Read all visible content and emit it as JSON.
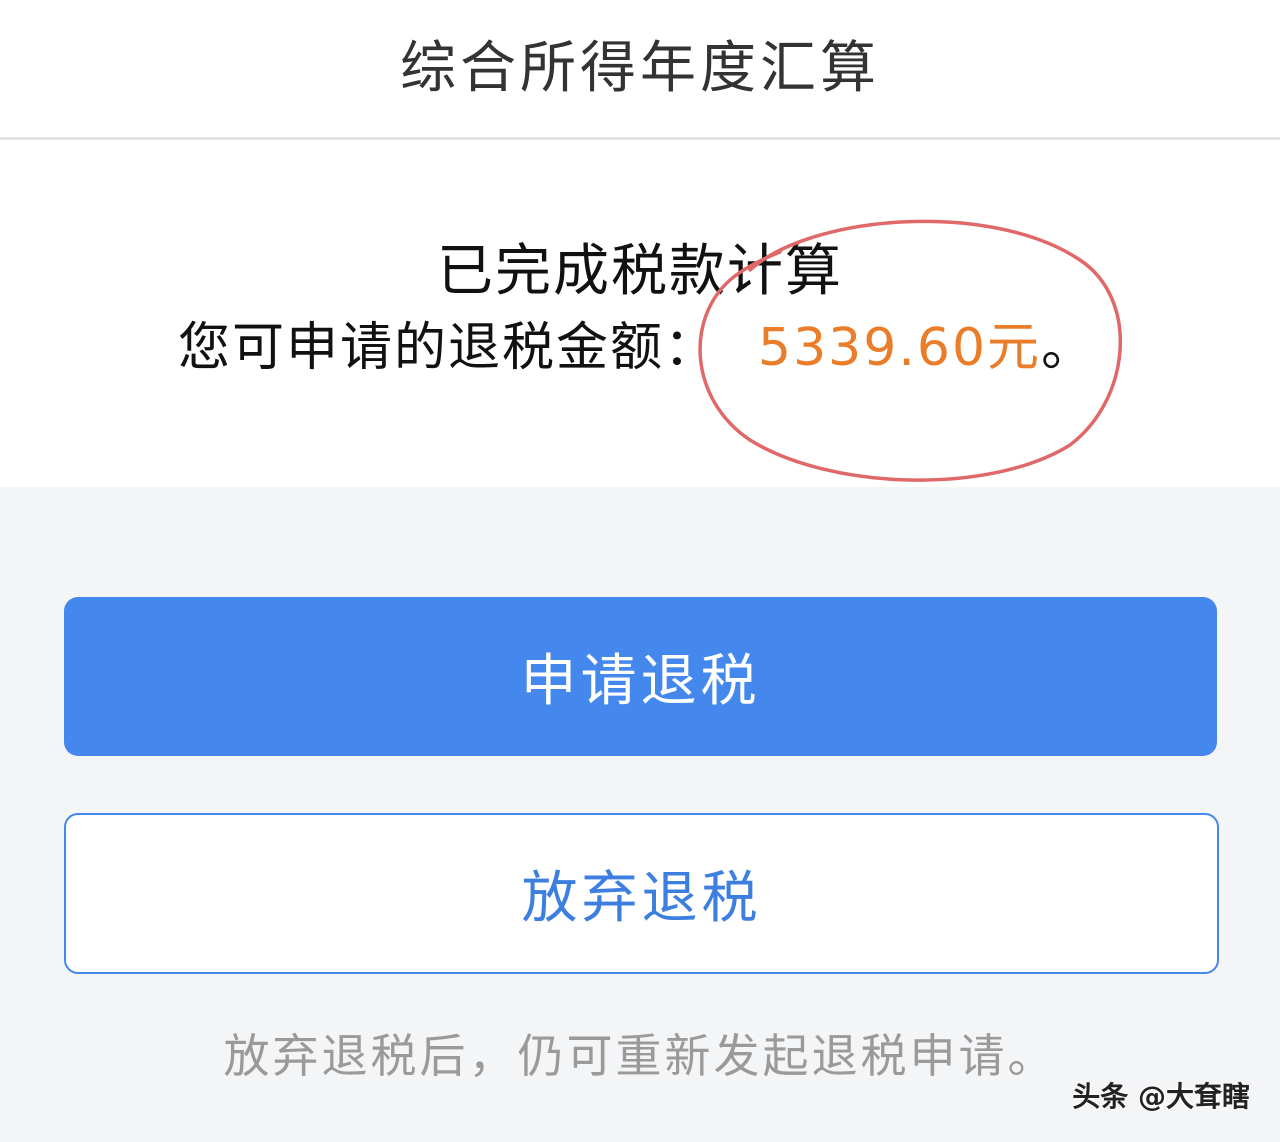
{
  "header": {
    "title": "综合所得年度汇算"
  },
  "result": {
    "status_text": "已完成税款计算",
    "refund_prefix": "您可申请的退税金额：",
    "refund_amount": "5339.60元",
    "refund_suffix": "。"
  },
  "actions": {
    "apply_label": "申请退税",
    "abandon_label": "放弃退税"
  },
  "hint": "放弃退税后，仍可重新发起退税申请。",
  "watermark": "头条 @大耷瞎",
  "colors": {
    "primary": "#4488ee",
    "amount": "#ea7d2a",
    "annotation_circle": "#e06868",
    "page_background": "#f4f5f7"
  }
}
